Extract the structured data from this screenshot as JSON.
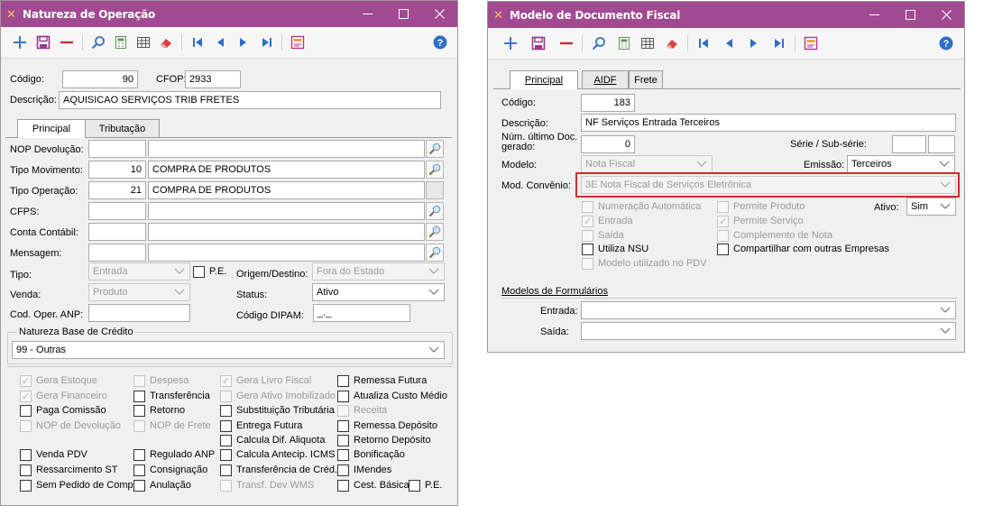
{
  "icons": {
    "app": "app-icon",
    "add": "plus-icon",
    "save": "save-icon",
    "remove": "minus-icon",
    "search": "search-icon",
    "calc": "calculator-icon",
    "grid": "grid-icon",
    "erase": "eraser-icon",
    "first": "first-icon",
    "prev": "prev-icon",
    "next": "next-icon",
    "last": "last-icon",
    "report": "report-icon",
    "help": "help-icon",
    "lookup": "lookup-icon"
  },
  "colors": {
    "titlebar": "#a14a92",
    "accent_blue": "#3a76c4",
    "highlight_border": "#d22b2b"
  },
  "left": {
    "title": "Natureza de Operação",
    "codigo_label": "Código:",
    "codigo_value": "90",
    "cfop_label": "CFOP:",
    "cfop_value": "2933",
    "descricao_label": "Descrição:",
    "descricao_value": "AQUISICAO SERVIÇOS TRIB FRETES",
    "tabs": [
      "Principal",
      "Tributação"
    ],
    "nop_devolucao_label": "NOP Devolução:",
    "tipo_movimento_label": "Tipo Movimento:",
    "tipo_movimento_code": "10",
    "tipo_movimento_desc": "COMPRA DE PRODUTOS",
    "tipo_operacao_label": "Tipo Operação:",
    "tipo_operacao_code": "21",
    "tipo_operacao_desc": "COMPRA DE PRODUTOS",
    "cfps_label": "CFPS:",
    "conta_contabil_label": "Conta Contábil:",
    "mensagem_label": "Mensagem:",
    "tipo_label": "Tipo:",
    "tipo_value": "Entrada",
    "pe_label": "P.E.",
    "origem_destino_label": "Origem/Destino:",
    "origem_destino_value": "Fora do Estado",
    "venda_label": "Venda:",
    "venda_value": "Produto",
    "status_label": "Status:",
    "status_value": "Ativo",
    "cod_oper_anp_label": "Cod. Oper. ANP:",
    "codigo_dipam_label": "Código DIPAM:",
    "codigo_dipam_value": "_._",
    "natureza_base_label": "Natureza Base de Crédito",
    "natureza_base_value": "99 - Outras",
    "checkboxes": [
      {
        "label": "Gera Estoque",
        "checked": true,
        "disabled": true
      },
      {
        "label": "Gera Financeiro",
        "checked": true,
        "disabled": true
      },
      {
        "label": "Paga Comissão",
        "checked": false,
        "disabled": false
      },
      {
        "label": "NOP de Devolução",
        "checked": false,
        "disabled": true
      },
      {
        "label": "Venda PDV",
        "checked": false,
        "disabled": false
      },
      {
        "label": "Ressarcimento ST",
        "checked": false,
        "disabled": false
      },
      {
        "label": "Sem Pedido de Compra",
        "checked": false,
        "disabled": false
      },
      {
        "label": "Despesa",
        "checked": false,
        "disabled": true
      },
      {
        "label": "Transferência",
        "checked": false,
        "disabled": false
      },
      {
        "label": "Retorno",
        "checked": false,
        "disabled": false
      },
      {
        "label": "NOP de Frete",
        "checked": false,
        "disabled": true
      },
      {
        "label": "Regulado ANP",
        "checked": false,
        "disabled": false
      },
      {
        "label": "Consignação",
        "checked": false,
        "disabled": false
      },
      {
        "label": "Anulação",
        "checked": false,
        "disabled": false
      },
      {
        "label": "Gera Livro Fiscal",
        "checked": true,
        "disabled": true
      },
      {
        "label": "Gera Ativo Imobilizado",
        "checked": false,
        "disabled": true
      },
      {
        "label": "Substituição Tributária",
        "checked": false,
        "disabled": false
      },
      {
        "label": "Entrega Futura",
        "checked": false,
        "disabled": false
      },
      {
        "label": "Calcula Dif. Aliquota",
        "checked": false,
        "disabled": false
      },
      {
        "label": "Calcula Antecip. ICMS",
        "checked": false,
        "disabled": false
      },
      {
        "label": "Transferência de Créd.",
        "checked": false,
        "disabled": false
      },
      {
        "label": "Transf. Dev WMS",
        "checked": false,
        "disabled": true
      },
      {
        "label": "Remessa Futura",
        "checked": false,
        "disabled": false
      },
      {
        "label": "Atualiza Custo Médio",
        "checked": false,
        "disabled": false
      },
      {
        "label": "Receita",
        "checked": false,
        "disabled": true
      },
      {
        "label": "Remessa Depósito",
        "checked": false,
        "disabled": false
      },
      {
        "label": "Retorno Depósito",
        "checked": false,
        "disabled": false
      },
      {
        "label": "Bonificação",
        "checked": false,
        "disabled": false
      },
      {
        "label": "IMendes",
        "checked": false,
        "disabled": false
      },
      {
        "label": "Cest. Básica",
        "checked": false,
        "disabled": false
      },
      {
        "label": "P.E.",
        "checked": false,
        "disabled": false
      }
    ]
  },
  "right": {
    "title": "Modelo de Documento Fiscal",
    "tabs": [
      "Principal",
      "AIDF",
      "Frete"
    ],
    "codigo_label": "Código:",
    "codigo_value": "183",
    "descricao_label": "Descrição:",
    "descricao_value": "NF Serviços Entrada Terceiros",
    "num_ultimo_label_1": "Núm. último Doc.",
    "num_ultimo_label_2": "gerado:",
    "num_ultimo_value": "0",
    "serie_label": "Série / Sub-série:",
    "modelo_label": "Modelo:",
    "modelo_value": "Nota Fiscal",
    "emissao_label": "Emissão:",
    "emissao_value": "Terceiros",
    "mod_convenio_label": "Mod. Convênio:",
    "mod_convenio_value": "3E Nota Fiscal de Serviços Eletrônica",
    "ativo_label": "Ativo:",
    "ativo_value": "Sim",
    "checkboxes": [
      {
        "label": "Numeração Automática",
        "checked": false,
        "disabled": true
      },
      {
        "label": "Entrada",
        "checked": true,
        "disabled": true
      },
      {
        "label": "Saída",
        "checked": false,
        "disabled": true
      },
      {
        "label": "Utiliza NSU",
        "checked": false,
        "disabled": false
      },
      {
        "label": "Modelo utilizado no PDV",
        "checked": false,
        "disabled": true
      },
      {
        "label": "Permite Produto",
        "checked": false,
        "disabled": true
      },
      {
        "label": "Permite Serviço",
        "checked": true,
        "disabled": true
      },
      {
        "label": "Complemento de Nota",
        "checked": false,
        "disabled": true
      },
      {
        "label": "Compartilhar com outras Empresas",
        "checked": false,
        "disabled": false
      }
    ],
    "modelos_formularios_label": "Modelos de Formulários",
    "entrada_label": "Entrada:",
    "saida_label": "Saída:"
  }
}
